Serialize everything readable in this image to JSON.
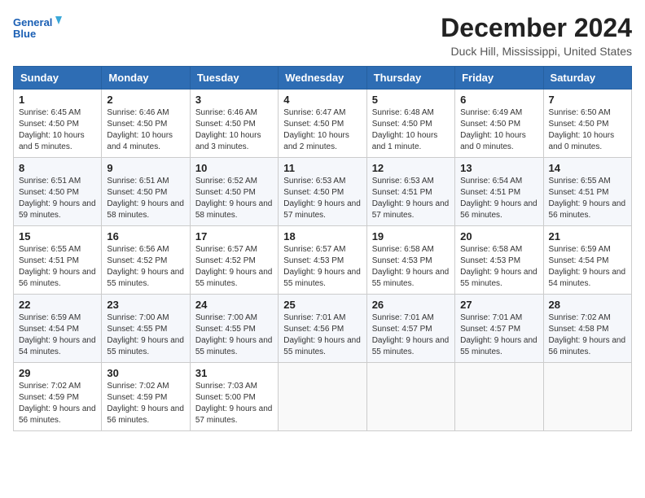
{
  "header": {
    "logo_line1": "General",
    "logo_line2": "Blue",
    "title": "December 2024",
    "subtitle": "Duck Hill, Mississippi, United States"
  },
  "weekdays": [
    "Sunday",
    "Monday",
    "Tuesday",
    "Wednesday",
    "Thursday",
    "Friday",
    "Saturday"
  ],
  "weeks": [
    [
      {
        "day": "1",
        "sunrise": "6:45 AM",
        "sunset": "4:50 PM",
        "daylight": "10 hours and 5 minutes."
      },
      {
        "day": "2",
        "sunrise": "6:46 AM",
        "sunset": "4:50 PM",
        "daylight": "10 hours and 4 minutes."
      },
      {
        "day": "3",
        "sunrise": "6:46 AM",
        "sunset": "4:50 PM",
        "daylight": "10 hours and 3 minutes."
      },
      {
        "day": "4",
        "sunrise": "6:47 AM",
        "sunset": "4:50 PM",
        "daylight": "10 hours and 2 minutes."
      },
      {
        "day": "5",
        "sunrise": "6:48 AM",
        "sunset": "4:50 PM",
        "daylight": "10 hours and 1 minute."
      },
      {
        "day": "6",
        "sunrise": "6:49 AM",
        "sunset": "4:50 PM",
        "daylight": "10 hours and 0 minutes."
      },
      {
        "day": "7",
        "sunrise": "6:50 AM",
        "sunset": "4:50 PM",
        "daylight": "10 hours and 0 minutes."
      }
    ],
    [
      {
        "day": "8",
        "sunrise": "6:51 AM",
        "sunset": "4:50 PM",
        "daylight": "9 hours and 59 minutes."
      },
      {
        "day": "9",
        "sunrise": "6:51 AM",
        "sunset": "4:50 PM",
        "daylight": "9 hours and 58 minutes."
      },
      {
        "day": "10",
        "sunrise": "6:52 AM",
        "sunset": "4:50 PM",
        "daylight": "9 hours and 58 minutes."
      },
      {
        "day": "11",
        "sunrise": "6:53 AM",
        "sunset": "4:50 PM",
        "daylight": "9 hours and 57 minutes."
      },
      {
        "day": "12",
        "sunrise": "6:53 AM",
        "sunset": "4:51 PM",
        "daylight": "9 hours and 57 minutes."
      },
      {
        "day": "13",
        "sunrise": "6:54 AM",
        "sunset": "4:51 PM",
        "daylight": "9 hours and 56 minutes."
      },
      {
        "day": "14",
        "sunrise": "6:55 AM",
        "sunset": "4:51 PM",
        "daylight": "9 hours and 56 minutes."
      }
    ],
    [
      {
        "day": "15",
        "sunrise": "6:55 AM",
        "sunset": "4:51 PM",
        "daylight": "9 hours and 56 minutes."
      },
      {
        "day": "16",
        "sunrise": "6:56 AM",
        "sunset": "4:52 PM",
        "daylight": "9 hours and 55 minutes."
      },
      {
        "day": "17",
        "sunrise": "6:57 AM",
        "sunset": "4:52 PM",
        "daylight": "9 hours and 55 minutes."
      },
      {
        "day": "18",
        "sunrise": "6:57 AM",
        "sunset": "4:53 PM",
        "daylight": "9 hours and 55 minutes."
      },
      {
        "day": "19",
        "sunrise": "6:58 AM",
        "sunset": "4:53 PM",
        "daylight": "9 hours and 55 minutes."
      },
      {
        "day": "20",
        "sunrise": "6:58 AM",
        "sunset": "4:53 PM",
        "daylight": "9 hours and 55 minutes."
      },
      {
        "day": "21",
        "sunrise": "6:59 AM",
        "sunset": "4:54 PM",
        "daylight": "9 hours and 54 minutes."
      }
    ],
    [
      {
        "day": "22",
        "sunrise": "6:59 AM",
        "sunset": "4:54 PM",
        "daylight": "9 hours and 54 minutes."
      },
      {
        "day": "23",
        "sunrise": "7:00 AM",
        "sunset": "4:55 PM",
        "daylight": "9 hours and 55 minutes."
      },
      {
        "day": "24",
        "sunrise": "7:00 AM",
        "sunset": "4:55 PM",
        "daylight": "9 hours and 55 minutes."
      },
      {
        "day": "25",
        "sunrise": "7:01 AM",
        "sunset": "4:56 PM",
        "daylight": "9 hours and 55 minutes."
      },
      {
        "day": "26",
        "sunrise": "7:01 AM",
        "sunset": "4:57 PM",
        "daylight": "9 hours and 55 minutes."
      },
      {
        "day": "27",
        "sunrise": "7:01 AM",
        "sunset": "4:57 PM",
        "daylight": "9 hours and 55 minutes."
      },
      {
        "day": "28",
        "sunrise": "7:02 AM",
        "sunset": "4:58 PM",
        "daylight": "9 hours and 56 minutes."
      }
    ],
    [
      {
        "day": "29",
        "sunrise": "7:02 AM",
        "sunset": "4:59 PM",
        "daylight": "9 hours and 56 minutes."
      },
      {
        "day": "30",
        "sunrise": "7:02 AM",
        "sunset": "4:59 PM",
        "daylight": "9 hours and 56 minutes."
      },
      {
        "day": "31",
        "sunrise": "7:03 AM",
        "sunset": "5:00 PM",
        "daylight": "9 hours and 57 minutes."
      },
      null,
      null,
      null,
      null
    ]
  ]
}
